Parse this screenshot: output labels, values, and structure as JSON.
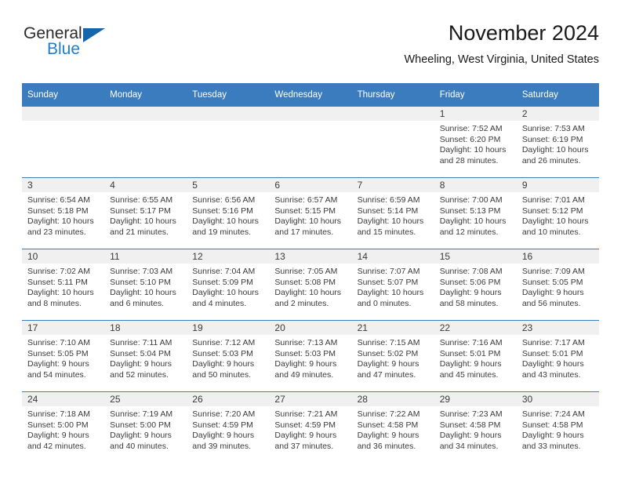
{
  "brand": {
    "name_part1": "General",
    "name_part2": "Blue",
    "accent_color": "#1b7fd4",
    "triangle_color": "#1565ad"
  },
  "header": {
    "month_title": "November 2024",
    "location": "Wheeling, West Virginia, United States"
  },
  "calendar": {
    "header_color": "#3a7cbe",
    "weekday_headers": [
      "Sunday",
      "Monday",
      "Tuesday",
      "Wednesday",
      "Thursday",
      "Friday",
      "Saturday"
    ],
    "weeks": [
      [
        {
          "day": "",
          "sunrise": "",
          "sunset": "",
          "daylight_line1": "",
          "daylight_line2": "",
          "empty": true
        },
        {
          "day": "",
          "sunrise": "",
          "sunset": "",
          "daylight_line1": "",
          "daylight_line2": "",
          "empty": true
        },
        {
          "day": "",
          "sunrise": "",
          "sunset": "",
          "daylight_line1": "",
          "daylight_line2": "",
          "empty": true
        },
        {
          "day": "",
          "sunrise": "",
          "sunset": "",
          "daylight_line1": "",
          "daylight_line2": "",
          "empty": true
        },
        {
          "day": "",
          "sunrise": "",
          "sunset": "",
          "daylight_line1": "",
          "daylight_line2": "",
          "empty": true
        },
        {
          "day": "1",
          "sunrise": "Sunrise: 7:52 AM",
          "sunset": "Sunset: 6:20 PM",
          "daylight_line1": "Daylight: 10 hours",
          "daylight_line2": "and 28 minutes.",
          "empty": false
        },
        {
          "day": "2",
          "sunrise": "Sunrise: 7:53 AM",
          "sunset": "Sunset: 6:19 PM",
          "daylight_line1": "Daylight: 10 hours",
          "daylight_line2": "and 26 minutes.",
          "empty": false
        }
      ],
      [
        {
          "day": "3",
          "sunrise": "Sunrise: 6:54 AM",
          "sunset": "Sunset: 5:18 PM",
          "daylight_line1": "Daylight: 10 hours",
          "daylight_line2": "and 23 minutes.",
          "empty": false
        },
        {
          "day": "4",
          "sunrise": "Sunrise: 6:55 AM",
          "sunset": "Sunset: 5:17 PM",
          "daylight_line1": "Daylight: 10 hours",
          "daylight_line2": "and 21 minutes.",
          "empty": false
        },
        {
          "day": "5",
          "sunrise": "Sunrise: 6:56 AM",
          "sunset": "Sunset: 5:16 PM",
          "daylight_line1": "Daylight: 10 hours",
          "daylight_line2": "and 19 minutes.",
          "empty": false
        },
        {
          "day": "6",
          "sunrise": "Sunrise: 6:57 AM",
          "sunset": "Sunset: 5:15 PM",
          "daylight_line1": "Daylight: 10 hours",
          "daylight_line2": "and 17 minutes.",
          "empty": false
        },
        {
          "day": "7",
          "sunrise": "Sunrise: 6:59 AM",
          "sunset": "Sunset: 5:14 PM",
          "daylight_line1": "Daylight: 10 hours",
          "daylight_line2": "and 15 minutes.",
          "empty": false
        },
        {
          "day": "8",
          "sunrise": "Sunrise: 7:00 AM",
          "sunset": "Sunset: 5:13 PM",
          "daylight_line1": "Daylight: 10 hours",
          "daylight_line2": "and 12 minutes.",
          "empty": false
        },
        {
          "day": "9",
          "sunrise": "Sunrise: 7:01 AM",
          "sunset": "Sunset: 5:12 PM",
          "daylight_line1": "Daylight: 10 hours",
          "daylight_line2": "and 10 minutes.",
          "empty": false
        }
      ],
      [
        {
          "day": "10",
          "sunrise": "Sunrise: 7:02 AM",
          "sunset": "Sunset: 5:11 PM",
          "daylight_line1": "Daylight: 10 hours",
          "daylight_line2": "and 8 minutes.",
          "empty": false
        },
        {
          "day": "11",
          "sunrise": "Sunrise: 7:03 AM",
          "sunset": "Sunset: 5:10 PM",
          "daylight_line1": "Daylight: 10 hours",
          "daylight_line2": "and 6 minutes.",
          "empty": false
        },
        {
          "day": "12",
          "sunrise": "Sunrise: 7:04 AM",
          "sunset": "Sunset: 5:09 PM",
          "daylight_line1": "Daylight: 10 hours",
          "daylight_line2": "and 4 minutes.",
          "empty": false
        },
        {
          "day": "13",
          "sunrise": "Sunrise: 7:05 AM",
          "sunset": "Sunset: 5:08 PM",
          "daylight_line1": "Daylight: 10 hours",
          "daylight_line2": "and 2 minutes.",
          "empty": false
        },
        {
          "day": "14",
          "sunrise": "Sunrise: 7:07 AM",
          "sunset": "Sunset: 5:07 PM",
          "daylight_line1": "Daylight: 10 hours",
          "daylight_line2": "and 0 minutes.",
          "empty": false
        },
        {
          "day": "15",
          "sunrise": "Sunrise: 7:08 AM",
          "sunset": "Sunset: 5:06 PM",
          "daylight_line1": "Daylight: 9 hours",
          "daylight_line2": "and 58 minutes.",
          "empty": false
        },
        {
          "day": "16",
          "sunrise": "Sunrise: 7:09 AM",
          "sunset": "Sunset: 5:05 PM",
          "daylight_line1": "Daylight: 9 hours",
          "daylight_line2": "and 56 minutes.",
          "empty": false
        }
      ],
      [
        {
          "day": "17",
          "sunrise": "Sunrise: 7:10 AM",
          "sunset": "Sunset: 5:05 PM",
          "daylight_line1": "Daylight: 9 hours",
          "daylight_line2": "and 54 minutes.",
          "empty": false
        },
        {
          "day": "18",
          "sunrise": "Sunrise: 7:11 AM",
          "sunset": "Sunset: 5:04 PM",
          "daylight_line1": "Daylight: 9 hours",
          "daylight_line2": "and 52 minutes.",
          "empty": false
        },
        {
          "day": "19",
          "sunrise": "Sunrise: 7:12 AM",
          "sunset": "Sunset: 5:03 PM",
          "daylight_line1": "Daylight: 9 hours",
          "daylight_line2": "and 50 minutes.",
          "empty": false
        },
        {
          "day": "20",
          "sunrise": "Sunrise: 7:13 AM",
          "sunset": "Sunset: 5:03 PM",
          "daylight_line1": "Daylight: 9 hours",
          "daylight_line2": "and 49 minutes.",
          "empty": false
        },
        {
          "day": "21",
          "sunrise": "Sunrise: 7:15 AM",
          "sunset": "Sunset: 5:02 PM",
          "daylight_line1": "Daylight: 9 hours",
          "daylight_line2": "and 47 minutes.",
          "empty": false
        },
        {
          "day": "22",
          "sunrise": "Sunrise: 7:16 AM",
          "sunset": "Sunset: 5:01 PM",
          "daylight_line1": "Daylight: 9 hours",
          "daylight_line2": "and 45 minutes.",
          "empty": false
        },
        {
          "day": "23",
          "sunrise": "Sunrise: 7:17 AM",
          "sunset": "Sunset: 5:01 PM",
          "daylight_line1": "Daylight: 9 hours",
          "daylight_line2": "and 43 minutes.",
          "empty": false
        }
      ],
      [
        {
          "day": "24",
          "sunrise": "Sunrise: 7:18 AM",
          "sunset": "Sunset: 5:00 PM",
          "daylight_line1": "Daylight: 9 hours",
          "daylight_line2": "and 42 minutes.",
          "empty": false
        },
        {
          "day": "25",
          "sunrise": "Sunrise: 7:19 AM",
          "sunset": "Sunset: 5:00 PM",
          "daylight_line1": "Daylight: 9 hours",
          "daylight_line2": "and 40 minutes.",
          "empty": false
        },
        {
          "day": "26",
          "sunrise": "Sunrise: 7:20 AM",
          "sunset": "Sunset: 4:59 PM",
          "daylight_line1": "Daylight: 9 hours",
          "daylight_line2": "and 39 minutes.",
          "empty": false
        },
        {
          "day": "27",
          "sunrise": "Sunrise: 7:21 AM",
          "sunset": "Sunset: 4:59 PM",
          "daylight_line1": "Daylight: 9 hours",
          "daylight_line2": "and 37 minutes.",
          "empty": false
        },
        {
          "day": "28",
          "sunrise": "Sunrise: 7:22 AM",
          "sunset": "Sunset: 4:58 PM",
          "daylight_line1": "Daylight: 9 hours",
          "daylight_line2": "and 36 minutes.",
          "empty": false
        },
        {
          "day": "29",
          "sunrise": "Sunrise: 7:23 AM",
          "sunset": "Sunset: 4:58 PM",
          "daylight_line1": "Daylight: 9 hours",
          "daylight_line2": "and 34 minutes.",
          "empty": false
        },
        {
          "day": "30",
          "sunrise": "Sunrise: 7:24 AM",
          "sunset": "Sunset: 4:58 PM",
          "daylight_line1": "Daylight: 9 hours",
          "daylight_line2": "and 33 minutes.",
          "empty": false
        }
      ]
    ]
  }
}
